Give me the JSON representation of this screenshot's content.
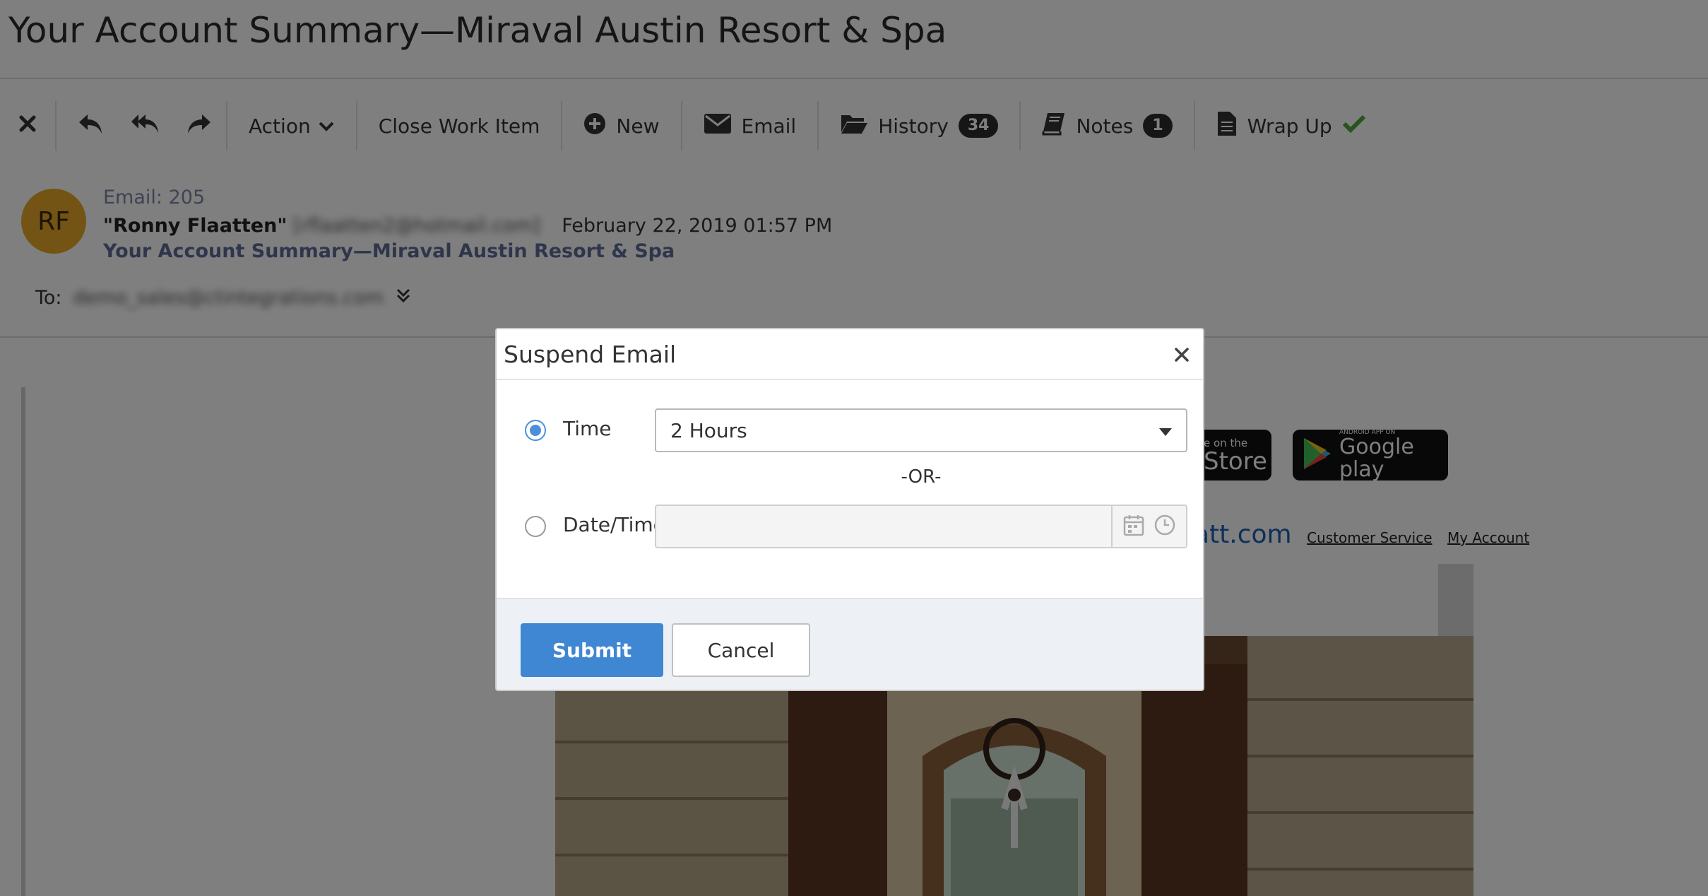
{
  "page": {
    "title": "Your Account Summary—Miraval Austin Resort & Spa"
  },
  "toolbar": {
    "action_label": "Action",
    "close_work_item_label": "Close Work Item",
    "new_label": "New",
    "email_label": "Email",
    "history_label": "History",
    "history_count": "34",
    "notes_label": "Notes",
    "notes_count": "1",
    "wrap_up_label": "Wrap Up",
    "icons": [
      "close-icon",
      "reply-icon",
      "reply-all-icon",
      "forward-icon",
      "chevron-down-icon",
      "plus-circle-icon",
      "envelope-icon",
      "folder-open-icon",
      "book-icon",
      "document-icon",
      "checkmark-icon"
    ]
  },
  "email": {
    "avatar_initials": "RF",
    "id_label": "Email: 205",
    "sender_name": "\"Ronny Flaatten\"",
    "sender_address": "[rflaatten2@hotmail.com]",
    "date": "February 22, 2019 01:57 PM",
    "subject": "Your Account Summary—Miraval Austin Resort & Spa",
    "to_label": "To:",
    "to_address": "demo_sales@ctintegrations.com"
  },
  "email_body": {
    "app_store_small": "e on the",
    "app_store_big": "Store",
    "google_small": "ANDROID APP ON",
    "google_big": "Google play",
    "domain_fragment": "att.com",
    "customer_service_link": "Customer Service",
    "my_account_link": "My Account"
  },
  "modal": {
    "title": "Suspend Email",
    "time_label": "Time",
    "time_selected": "2 Hours",
    "or_label": "-OR-",
    "datetime_label": "Date/Time",
    "datetime_value": "",
    "submit_label": "Submit",
    "cancel_label": "Cancel",
    "accent_color": "#3f87d3"
  }
}
